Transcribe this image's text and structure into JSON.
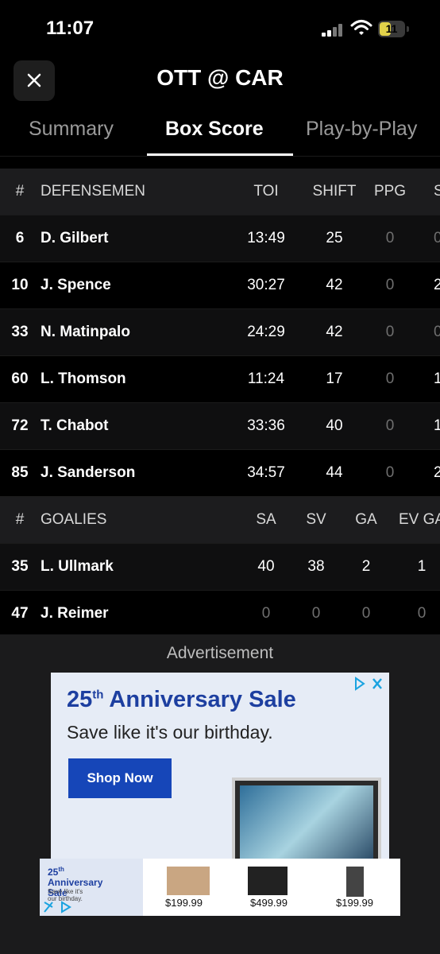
{
  "status_bar": {
    "time": "11:07",
    "battery": "11"
  },
  "header": {
    "title": "OTT @ CAR"
  },
  "tabs": [
    {
      "label": "Summary",
      "active": false
    },
    {
      "label": "Box Score",
      "active": true
    },
    {
      "label": "Play-by-Play",
      "active": false
    }
  ],
  "defensemen": {
    "headers": {
      "num": "#",
      "name": "DEFENSEMEN",
      "c1": "TOI",
      "c2": "SHIFT",
      "c3": "PPG",
      "c4": "S"
    },
    "rows": [
      {
        "num": "6",
        "name": "D. Gilbert",
        "toi": "13:49",
        "shift": "25",
        "ppg": "0",
        "s": "0"
      },
      {
        "num": "10",
        "name": "J. Spence",
        "toi": "30:27",
        "shift": "42",
        "ppg": "0",
        "s": "2"
      },
      {
        "num": "33",
        "name": "N. Matinpalo",
        "toi": "24:29",
        "shift": "42",
        "ppg": "0",
        "s": "0"
      },
      {
        "num": "60",
        "name": "L. Thomson",
        "toi": "11:24",
        "shift": "17",
        "ppg": "0",
        "s": "1"
      },
      {
        "num": "72",
        "name": "T. Chabot",
        "toi": "33:36",
        "shift": "40",
        "ppg": "0",
        "s": "1"
      },
      {
        "num": "85",
        "name": "J. Sanderson",
        "toi": "34:57",
        "shift": "44",
        "ppg": "0",
        "s": "2"
      }
    ]
  },
  "goalies": {
    "headers": {
      "num": "#",
      "name": "GOALIES",
      "c1": "SA",
      "c2": "SV",
      "c3": "GA",
      "c4": "EV GA"
    },
    "rows": [
      {
        "num": "35",
        "name": "L. Ullmark",
        "sa": "40",
        "sv": "38",
        "ga": "2",
        "evga": "1"
      },
      {
        "num": "47",
        "name": "J. Reimer",
        "sa": "0",
        "sv": "0",
        "ga": "0",
        "evga": "0"
      }
    ]
  },
  "ad": {
    "label": "Advertisement",
    "headline_num": "25",
    "headline_sup": "th",
    "headline_rest": " Anniversary Sale",
    "sub": "Save like it's our birthday.",
    "cta": "Shop Now"
  },
  "banner": {
    "title_num": "25",
    "title_sup": "th",
    "title_rest": " Anniversary Sale",
    "sub": "Save like it's our birthday.",
    "prices": [
      "$199.99",
      "$499.99",
      "$199.99"
    ]
  }
}
